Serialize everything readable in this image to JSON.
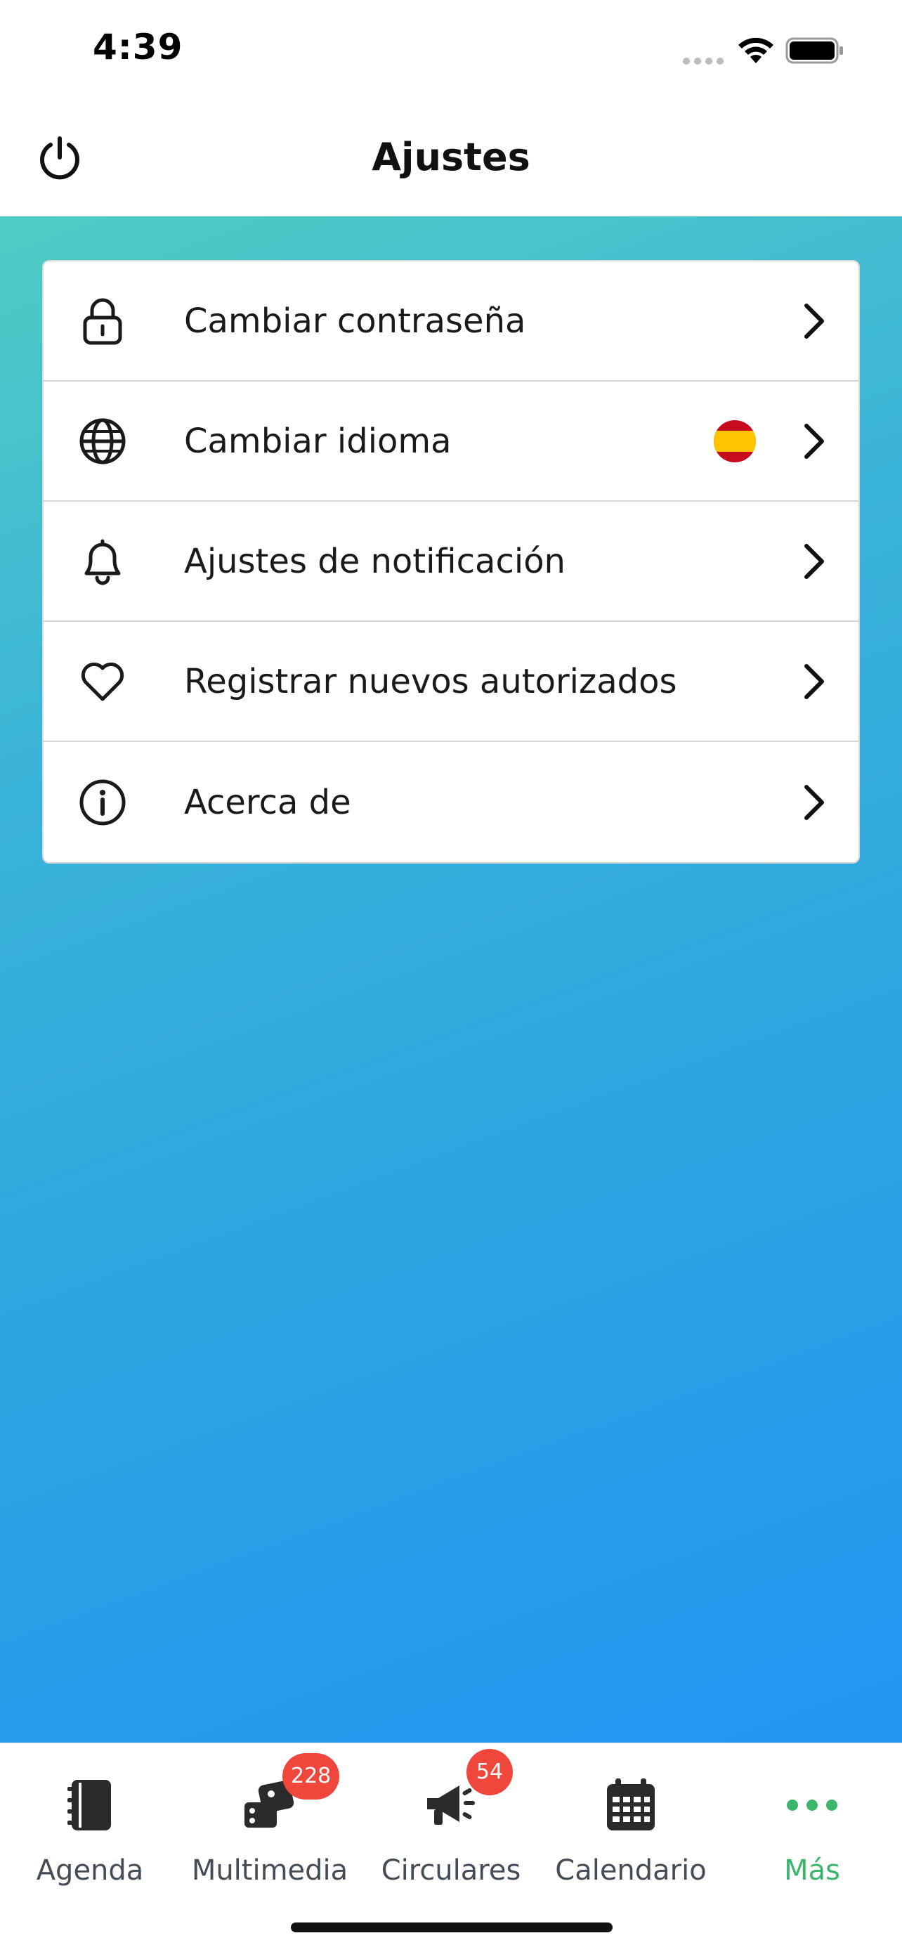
{
  "status_bar": {
    "time": "4:39"
  },
  "header": {
    "title": "Ajustes"
  },
  "settings": {
    "items": [
      {
        "label": "Cambiar contraseña",
        "icon": "lock-icon"
      },
      {
        "label": "Cambiar idioma",
        "icon": "globe-icon",
        "flag": "spain-flag-icon"
      },
      {
        "label": "Ajustes de notificación",
        "icon": "bell-icon"
      },
      {
        "label": "Registrar nuevos autorizados",
        "icon": "heart-icon"
      },
      {
        "label": "Acerca de",
        "icon": "info-icon"
      }
    ]
  },
  "tabbar": {
    "tabs": [
      {
        "label": "Agenda",
        "icon": "notebook-icon"
      },
      {
        "label": "Multimedia",
        "icon": "media-icon",
        "badge": "228"
      },
      {
        "label": "Circulares",
        "icon": "megaphone-icon",
        "badge": "54"
      },
      {
        "label": "Calendario",
        "icon": "calendar-icon"
      },
      {
        "label": "Más",
        "icon": "more-dots-icon",
        "active": true
      }
    ]
  },
  "colors": {
    "accent_green": "#3cb66d",
    "badge_red": "#f0473d",
    "gradient_start": "#4ecdc4",
    "gradient_end": "#2196f3"
  }
}
